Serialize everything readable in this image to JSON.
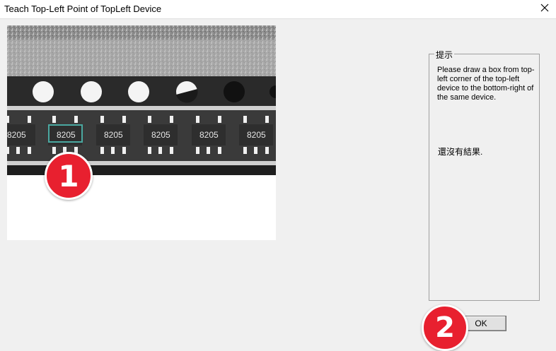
{
  "window": {
    "title": "Teach Top-Left Point of TopLeft Device",
    "close_icon": "close-icon"
  },
  "image": {
    "chip_labels": [
      "8205",
      "8205",
      "8205",
      "8205",
      "8205",
      "8205"
    ]
  },
  "hint_group": {
    "legend": "提示",
    "instruction": "Please draw a box from top-left corner of the top-left device to the bottom-right of the same device.",
    "result": "還沒有結果."
  },
  "buttons": {
    "ok_label": "OK"
  },
  "annotations": {
    "badge_1": "1",
    "badge_2": "2"
  },
  "colors": {
    "badge": "#e8202f",
    "selection_box": "#4aa8a0"
  }
}
